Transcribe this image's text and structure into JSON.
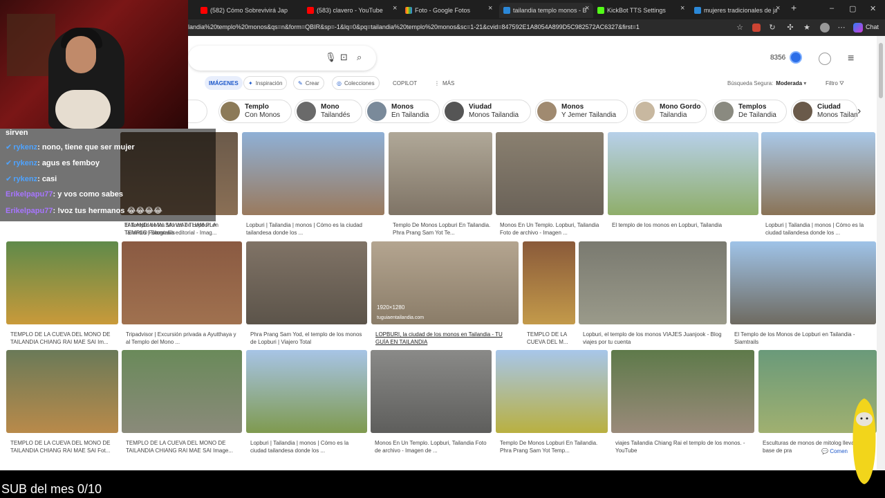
{
  "browser": {
    "tabs": [
      {
        "label": "(582) Cómo Sobrevivirá Jap",
        "color": "#ff0000"
      },
      {
        "label": "(583) clavero - YouTube",
        "color": "#ff0000"
      },
      {
        "label": "Foto - Google Fotos",
        "color": "#fbbc04"
      },
      {
        "label": "tailandia templo monos - B",
        "color": "#2b88d8"
      },
      {
        "label": "KickBot TTS Settings",
        "color": "#53fc18"
      },
      {
        "label": "mujeres tradicionales de jap",
        "color": "#2b88d8"
      }
    ],
    "url_text": "landia%20templo%20monos&qs=n&form=QBIR&sp=-1&lq=0&pq=tailandia%20templo%20monos&sc=1-21&cvid=847592E1A8054A899D5C982572AC6327&first=1",
    "chat_button": "Chat"
  },
  "header": {
    "points": "8356",
    "safe_search_label": "Búsqueda Segura:",
    "safe_search_value": "Moderada",
    "filter_label": "Filtro"
  },
  "nav": {
    "images": "IMÁGENES",
    "inspiration": "Inspiración",
    "create": "Crear",
    "collections": "Colecciones",
    "copilot": "COPILOT",
    "more": "MÁS"
  },
  "chips": [
    {
      "line1": "",
      "line2": "andia"
    },
    {
      "line1": "Templo",
      "line2": "Con Monos"
    },
    {
      "line1": "Mono",
      "line2": "Tailandés"
    },
    {
      "line1": "Monos",
      "line2": "En Tailandia"
    },
    {
      "line1": "Viudad",
      "line2": "Monos Tailandia"
    },
    {
      "line1": "Monos",
      "line2": "Y Jemer Tailandia"
    },
    {
      "line1": "Mono Gordo",
      "line2": "Tailandia"
    },
    {
      "line1": "Templos",
      "line2": "De Tailandia"
    },
    {
      "line1": "Ciudad",
      "line2": "Monos Tailan"
    }
  ],
  "results": {
    "row1": [
      "TAILANDIA MAI SAI WAT THAM PLA TEMPLO Fotografía editorial - Imag...",
      "El Templo de los Monos de Lopburi en Tailandia | Siamtrails",
      "Lopburi | Tailandia | monos | Cómo es la ciudad tailandesa donde los ...",
      "Templo De Monos Lopburi En Tailandia. Phra Prang Sam Yot Te...",
      "Monos En Un Templo. Lopburi, Tailandia Foto de archivo - Imagen ...",
      "El templo de los monos en Lopburi, Tailandia",
      "Lopburi | Tailandia | monos | Cómo es la ciudad tailandesa donde los ..."
    ],
    "row2": [
      "TEMPLO DE LA CUEVA DEL MONO DE TAILANDIA CHIANG RAI MAE SAI Im...",
      "Tripadvisor | Excursión privada a Ayutthaya y al Templo del Mono ...",
      "Phra Prang Sam Yod, el templo de los monos de Lopburi | Viajero Total",
      "LOPBURI, la ciudad de los monos en Tailandia - TU GUÍA EN TAILANDIA",
      "TEMPLO DE LA CUEVA DEL M...",
      "Lopburi, el templo de los monos VIAJES Juanjook - Blog viajes por tu cuenta",
      "El Templo de los Monos de Lopburi en Tailandia - Siamtrails"
    ],
    "row3": [
      "TEMPLO DE LA CUEVA DEL MONO DE TAILANDIA CHIANG RAI MAE SAI Fot...",
      "TEMPLO DE LA CUEVA DEL MONO DE TAILANDIA CHIANG RAI MAE SAI Image...",
      "Lopburi | Tailandia | monos | Cómo es la ciudad tailandesa donde los ...",
      "Monos En Un Templo. Lopburi, Tailandia Foto de archivo - Imagen de ...",
      "Templo De Monos Lopburi En Tailandia. Phra Prang Sam Yot Temp...",
      "viajes Tailandia Chiang Rai el templo de los monos. - YouTube",
      "Esculturas de monos de mitolog llevan la base de pra"
    ],
    "hover_dims": "1920×1280",
    "hover_source": "tuguiaentailandia.com",
    "comment": "Comen"
  },
  "stream": {
    "chat": [
      {
        "user": "",
        "text": "sirven"
      },
      {
        "user": "rykenz",
        "text": "nono, tiene que ser mujer"
      },
      {
        "user": "rykenz",
        "text": "agus es femboy"
      },
      {
        "user": "rykenz",
        "text": "casi"
      },
      {
        "user": "Erikelpapu77",
        "text": "y vos como sabes"
      },
      {
        "user": "Erikelpapu77",
        "text": "!voz tus hermanos 😂😂😂😂"
      }
    ],
    "sub_goal": "SUB del mes 0/10"
  }
}
